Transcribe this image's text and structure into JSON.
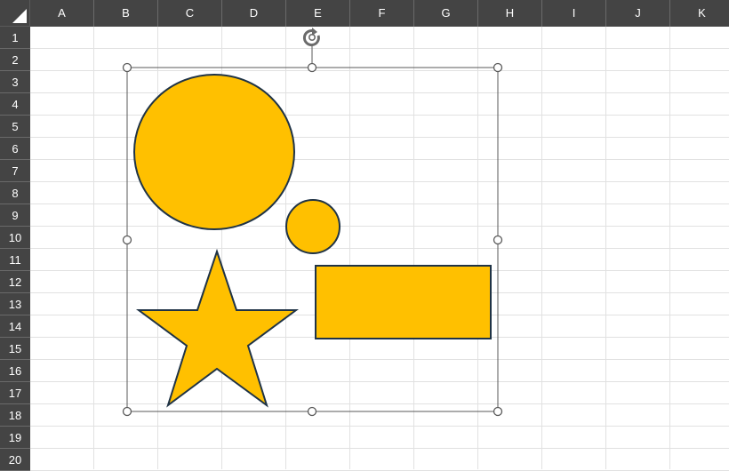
{
  "columns": [
    "A",
    "B",
    "C",
    "D",
    "E",
    "F",
    "G",
    "H",
    "I",
    "J",
    "K"
  ],
  "rows": [
    "1",
    "2",
    "3",
    "4",
    "5",
    "6",
    "7",
    "8",
    "9",
    "10",
    "11",
    "12",
    "13",
    "14",
    "15",
    "16",
    "17",
    "18",
    "19",
    "20"
  ],
  "shapes": {
    "fill_color": "#FFC000",
    "outline_color": "#1F3346",
    "selection_color": "#595959",
    "items": [
      "large-circle",
      "small-circle",
      "star",
      "rectangle"
    ]
  },
  "icons": {
    "rotate_handle": "rotate-icon",
    "select_all": "select-all-triangle-icon"
  }
}
